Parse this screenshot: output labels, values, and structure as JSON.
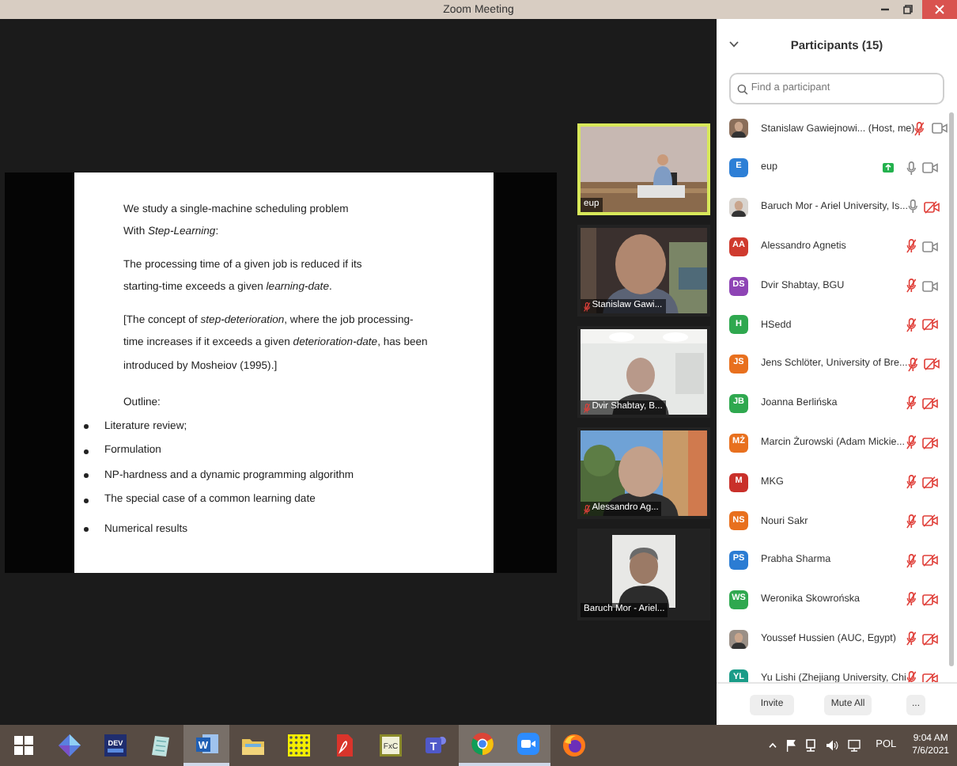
{
  "window": {
    "title": "Zoom Meeting"
  },
  "slide": {
    "paragraphs": [
      "We study a single-machine scheduling problem\nWith *Step-Learning*:",
      "The processing time of a given job is reduced if its\nstarting-time exceeds a given *learning-date*.",
      "[The concept of *step-deterioration*, where the job processing-\ntime increases if it exceeds a given *deterioration-date*, has been\nintroduced by Mosheiov (1995).]"
    ],
    "outline_title": "Outline:",
    "bullets": [
      "Literature review;",
      "Formulation",
      "NP-hardness and a dynamic programming algorithm",
      "The special case of a common learning date",
      "Numerical results"
    ]
  },
  "video_tiles": [
    {
      "name": "eup",
      "kind": "video",
      "active_speaker": true,
      "muted": false
    },
    {
      "name": "Stanislaw Gawi...",
      "kind": "video",
      "active_speaker": false,
      "muted": true
    },
    {
      "name": "Dvir Shabtay, B...",
      "kind": "video",
      "active_speaker": false,
      "muted": true
    },
    {
      "name": "Alessandro Ag...",
      "kind": "video",
      "active_speaker": false,
      "muted": true
    },
    {
      "name": "Baruch Mor - Ariel...",
      "kind": "profile_photo",
      "active_speaker": false,
      "muted": false
    }
  ],
  "participants_panel": {
    "title": "Participants (15)",
    "search": {
      "placeholder": "Find a participant"
    },
    "participants": [
      {
        "name": "Stanislaw Gawiejnowi... (Host, me)",
        "sharing": false,
        "muted": true,
        "video_on": true
      },
      {
        "name": "eup",
        "avatar": {
          "kind": "initials",
          "initials": "E",
          "color": "#2d7fd6"
        },
        "sharing": true,
        "muted": false,
        "video_on": true
      },
      {
        "name": "Baruch Mor - Ariel University, Is...",
        "sharing": false,
        "muted": false,
        "video_on": false
      },
      {
        "name": "Alessandro Agnetis",
        "avatar": {
          "kind": "initials",
          "initials": "AA",
          "color": "#cf3a2e"
        },
        "sharing": false,
        "muted": true,
        "video_on": true
      },
      {
        "name": "Dvir Shabtay, BGU",
        "avatar": {
          "kind": "initials",
          "initials": "DS",
          "color": "#8e44b5"
        },
        "sharing": false,
        "muted": true,
        "video_on": true
      },
      {
        "name": "HSedd",
        "avatar": {
          "kind": "initials",
          "initials": "H",
          "color": "#2fa84f"
        },
        "sharing": false,
        "muted": true,
        "video_on": false
      },
      {
        "name": "Jens Schlöter, University of Bre...",
        "avatar": {
          "kind": "initials",
          "initials": "JS",
          "color": "#e8701e"
        },
        "sharing": false,
        "muted": true,
        "video_on": false
      },
      {
        "name": "Joanna Berlińska",
        "avatar": {
          "kind": "initials",
          "initials": "JB",
          "color": "#2fa84f"
        },
        "sharing": false,
        "muted": true,
        "video_on": false
      },
      {
        "name": "Marcin Żurowski (Adam Mickie...",
        "avatar": {
          "kind": "initials",
          "initials": "MŻ",
          "color": "#e8701e"
        },
        "sharing": false,
        "muted": true,
        "video_on": false
      },
      {
        "name": "MKG",
        "avatar": {
          "kind": "initials",
          "initials": "M",
          "color": "#c9302a"
        },
        "sharing": false,
        "muted": true,
        "video_on": false
      },
      {
        "name": "Nouri Sakr",
        "avatar": {
          "kind": "initials",
          "initials": "NS",
          "color": "#e8701e"
        },
        "sharing": false,
        "muted": true,
        "video_on": false
      },
      {
        "name": "Prabha Sharma",
        "avatar": {
          "kind": "initials",
          "initials": "PS",
          "color": "#2b7cd3"
        },
        "sharing": false,
        "muted": true,
        "video_on": false
      },
      {
        "name": "Weronika Skowrońska",
        "avatar": {
          "kind": "initials",
          "initials": "WS",
          "color": "#2fa84f"
        },
        "sharing": false,
        "muted": true,
        "video_on": false
      },
      {
        "name": "Youssef Hussien (AUC, Egypt)",
        "sharing": false,
        "muted": true,
        "video_on": false
      },
      {
        "name": "Yu Lishi (Zhejiang University, Chi",
        "avatar": {
          "kind": "initials",
          "initials": "YL",
          "color": "#1a9c88"
        },
        "sharing": false,
        "muted": true,
        "video_on": false
      }
    ],
    "buttons": [
      "Invite",
      "Mute All",
      "..."
    ]
  },
  "taskbar": {
    "apps": [
      {
        "kind": "windows",
        "active": false
      },
      {
        "kind": "diamond",
        "active": false
      },
      {
        "kind": "dev",
        "glyph": "DEV",
        "active": false
      },
      {
        "kind": "notes",
        "active": false
      },
      {
        "kind": "word",
        "glyph": "W",
        "active": true
      },
      {
        "kind": "folder",
        "active": false
      },
      {
        "kind": "grid",
        "active": false
      },
      {
        "kind": "pdf",
        "active": false
      },
      {
        "kind": "fxc",
        "glyph": "FxC",
        "active": false
      },
      {
        "kind": "teams",
        "glyph": "T",
        "active": false
      },
      {
        "kind": "chrome",
        "active": true
      },
      {
        "kind": "zoom",
        "active": true
      },
      {
        "kind": "firefox",
        "active": false
      }
    ],
    "tray": {
      "language": "POL",
      "time": "9:04 AM",
      "date": "7/6/2021"
    }
  }
}
